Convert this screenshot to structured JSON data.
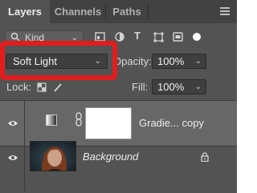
{
  "tabs": [
    {
      "label": "Layers",
      "active": true
    },
    {
      "label": "Channels",
      "active": false
    },
    {
      "label": "Paths",
      "active": false
    }
  ],
  "filter": {
    "kind_label": "Kind",
    "icons": [
      "pixel-filter-icon",
      "adjustment-filter-icon",
      "type-filter-icon",
      "shape-filter-icon",
      "smart-object-filter-icon",
      "filter-toggle-icon"
    ]
  },
  "blend": {
    "mode_value": "Soft Light",
    "opacity_label": "Opacity:",
    "opacity_value": "100%"
  },
  "lock": {
    "label": "Lock:",
    "fill_label": "Fill:",
    "fill_value": "100%"
  },
  "layers": [
    {
      "name": "Gradie... copy",
      "type": "gradient-fill",
      "selected": true,
      "visible": true
    },
    {
      "name": "Background",
      "type": "pixel",
      "selected": false,
      "visible": true,
      "locked": true
    }
  ],
  "colors": {
    "panel": "#535353",
    "selected_row": "#676767",
    "highlight": "#e11d1d"
  }
}
